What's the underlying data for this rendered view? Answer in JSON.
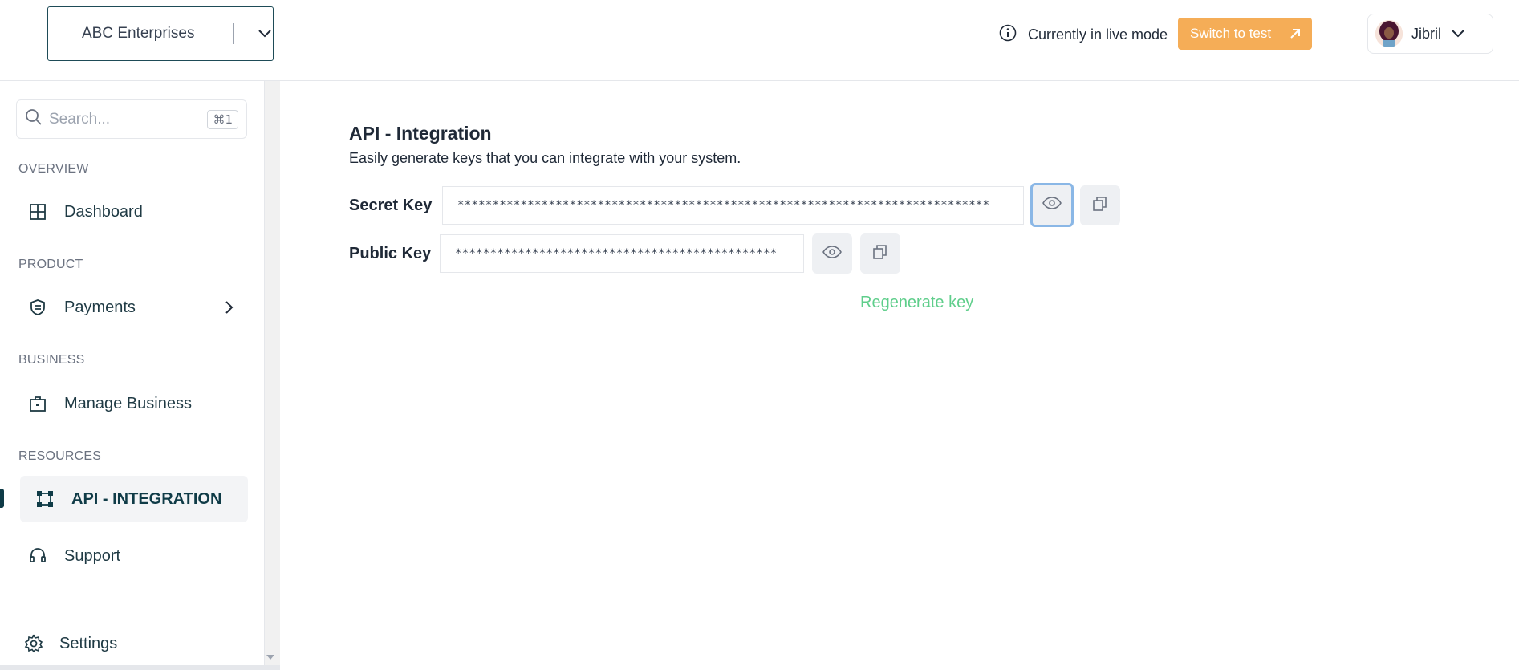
{
  "header": {
    "business_name": "ABC Enterprises",
    "mode_text": "Currently in live mode",
    "switch_label": "Switch to test",
    "user_name": "Jibril"
  },
  "sidebar": {
    "search_placeholder": "Search...",
    "search_shortcut": "⌘1",
    "sections": {
      "overview": "OVERVIEW",
      "product": "PRODUCT",
      "business": "BUSINESS",
      "resources": "RESOURCES"
    },
    "items": {
      "dashboard": "Dashboard",
      "payments": "Payments",
      "manage_business": "Manage Business",
      "api_integration": "API - INTEGRATION",
      "support": "Support",
      "settings": "Settings"
    }
  },
  "main": {
    "title": "API - Integration",
    "subtitle": "Easily generate keys that you can integrate with your system.",
    "secret_key_label": "Secret Key",
    "secret_key_value": "****************************************************************************",
    "public_key_label": "Public Key",
    "public_key_value": "**********************************************",
    "regenerate_label": "Regenerate key"
  },
  "colors": {
    "accent": "#f5ad57",
    "primary": "#0f3b47",
    "success": "#5fce8b"
  }
}
